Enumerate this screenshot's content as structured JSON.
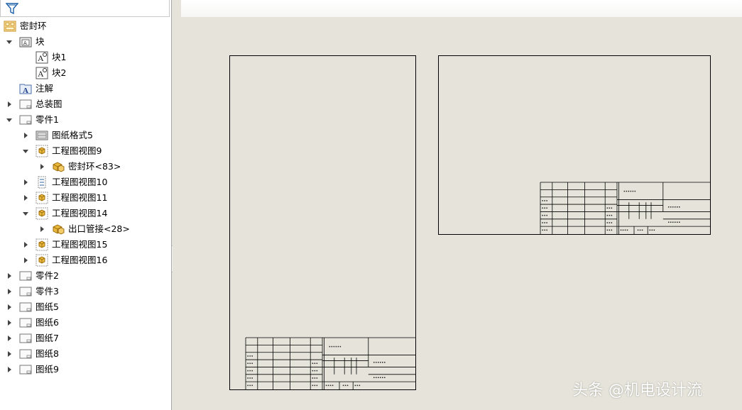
{
  "tree": {
    "items": [
      {
        "label": "密封环",
        "icon": "drawing-root-icon",
        "level": 0,
        "expander": "none"
      },
      {
        "label": "块",
        "icon": "block-folder-icon",
        "level": 0,
        "expander": "expanded"
      },
      {
        "label": "块1",
        "icon": "block-icon",
        "level": 1,
        "expander": "none"
      },
      {
        "label": "块2",
        "icon": "block-icon",
        "level": 1,
        "expander": "none"
      },
      {
        "label": "注解",
        "icon": "annotation-icon",
        "level": 0,
        "expander": "none"
      },
      {
        "label": "总装图",
        "icon": "sheet-icon",
        "level": 0,
        "expander": "collapsed"
      },
      {
        "label": "零件1",
        "icon": "sheet-icon",
        "level": 0,
        "expander": "expanded"
      },
      {
        "label": "图纸格式5",
        "icon": "sheet-format-icon",
        "level": 1,
        "expander": "collapsed"
      },
      {
        "label": "工程图视图9",
        "icon": "drawing-view-icon",
        "level": 1,
        "expander": "expanded"
      },
      {
        "label": "密封环<83>",
        "icon": "part-icon",
        "level": 2,
        "expander": "collapsed"
      },
      {
        "label": "工程图视图10",
        "icon": "section-view-icon",
        "level": 1,
        "expander": "collapsed"
      },
      {
        "label": "工程图视图11",
        "icon": "drawing-view-icon",
        "level": 1,
        "expander": "collapsed"
      },
      {
        "label": "工程图视图14",
        "icon": "drawing-view-icon",
        "level": 1,
        "expander": "expanded"
      },
      {
        "label": "出口管接<28>",
        "icon": "part-icon",
        "level": 2,
        "expander": "collapsed"
      },
      {
        "label": "工程图视图15",
        "icon": "drawing-view-icon",
        "level": 1,
        "expander": "collapsed"
      },
      {
        "label": "工程图视图16",
        "icon": "drawing-view-icon",
        "level": 1,
        "expander": "collapsed"
      },
      {
        "label": "零件2",
        "icon": "sheet-icon",
        "level": 0,
        "expander": "collapsed"
      },
      {
        "label": "零件3",
        "icon": "sheet-icon",
        "level": 0,
        "expander": "collapsed"
      },
      {
        "label": "图纸5",
        "icon": "sheet-icon",
        "level": 0,
        "expander": "collapsed"
      },
      {
        "label": "图纸6",
        "icon": "sheet-icon",
        "level": 0,
        "expander": "collapsed"
      },
      {
        "label": "图纸7",
        "icon": "sheet-icon",
        "level": 0,
        "expander": "collapsed"
      },
      {
        "label": "图纸8",
        "icon": "sheet-icon",
        "level": 0,
        "expander": "collapsed"
      },
      {
        "label": "图纸9",
        "icon": "sheet-icon",
        "level": 0,
        "expander": "collapsed"
      }
    ]
  },
  "filter": {
    "icon": "filter-icon"
  },
  "sheets": [
    {
      "name": "portrait-sheet"
    },
    {
      "name": "landscape-sheet"
    }
  ],
  "watermark": {
    "text": "头条 @机电设计流"
  },
  "colors": {
    "canvas": "#e6e4da",
    "panel": "#ffffff",
    "icon_yellow": "#e8b93c"
  }
}
